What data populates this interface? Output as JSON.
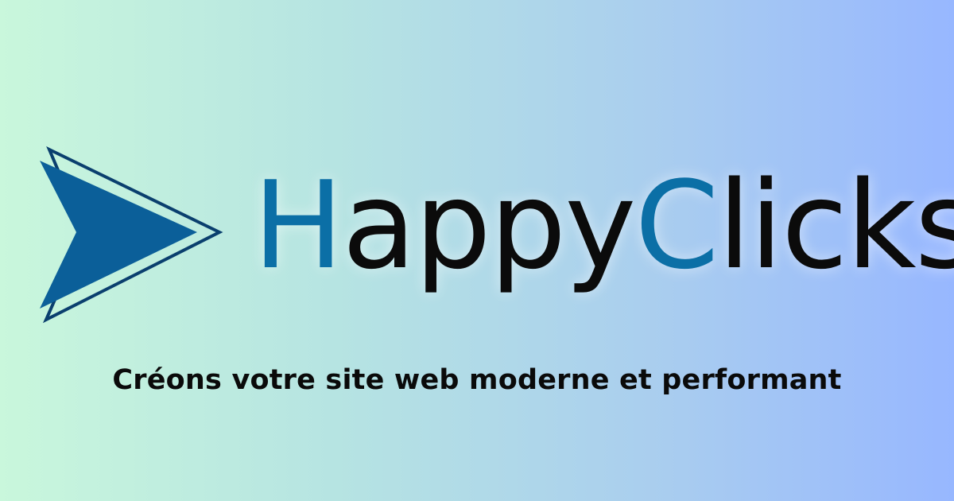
{
  "brand": {
    "name_part1_accent": "H",
    "name_part2": "appy",
    "name_part3_accent": "C",
    "name_part4": "licks",
    "accent_color": "#0b6fa6",
    "logo_color_primary": "#0b5f99",
    "logo_color_dark": "#0a3f6e",
    "logo_icon": "play-arrow-icon"
  },
  "tagline": "Créons votre site web moderne et performant",
  "background": {
    "gradient_start": "#c9f7dc",
    "gradient_end": "#97b7ff"
  }
}
